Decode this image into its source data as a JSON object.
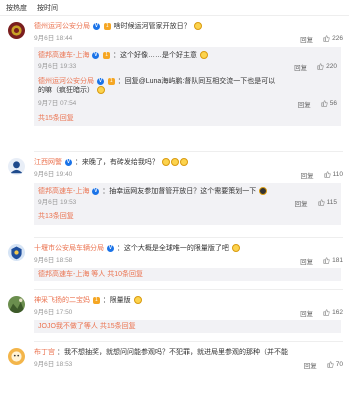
{
  "tabs": [
    {
      "label": "按热度"
    },
    {
      "label": "按时间"
    }
  ],
  "actions": {
    "reply_label": "回复"
  },
  "comments": [
    {
      "user": "德州运河公安分局",
      "text": "啥时候运河管家开放日？",
      "time": "9月6日 18:44",
      "likes": "226",
      "replies": [
        {
          "user": "德邦高速车-上海",
          "text": "：这个好像……是个好主意",
          "time": "9月6日 19:33",
          "likes": "220"
        },
        {
          "user": "德州运河公安分局",
          "text": "：回复@Luna海屿鹏:督队同互相交流一下也是可以的嘛（疯狂暗示）",
          "time": "9月7日 07:54",
          "likes": "56"
        }
      ],
      "more_label": "共15条回复"
    },
    {
      "user": "江西网警",
      "text": "：来晚了，有砖发给我吗？",
      "time": "9月6日 19:40",
      "likes": "110",
      "replies": [
        {
          "user": "德邦高速车-上海",
          "text": "：抽幸运网友参加督管开放日？这个需要策划一下",
          "time": "9月6日 19:53",
          "likes": "115"
        }
      ],
      "more_label": "共13条回复"
    },
    {
      "user": "十堰市公安局车辆分局",
      "text": "：这个大概是全球唯一的限量版了吧",
      "time": "9月6日 18:58",
      "likes": "181",
      "replies": [],
      "more_label": "德邦高速车-上海 等人 共10条回复"
    },
    {
      "user": "神采飞扬的二宝妈",
      "text": "：限量版",
      "time": "9月6日 17:50",
      "likes": "162",
      "replies": [],
      "more_label": "JOJO我不做了等人 共15条回复"
    },
    {
      "user": "布丁宫",
      "text": "：我不想抽奖，就想问问能参观吗？不犯罪，就进局里参观的那种（并不能",
      "time": "9月6日 18:53",
      "likes": "70",
      "replies": [],
      "more_label": ""
    }
  ]
}
